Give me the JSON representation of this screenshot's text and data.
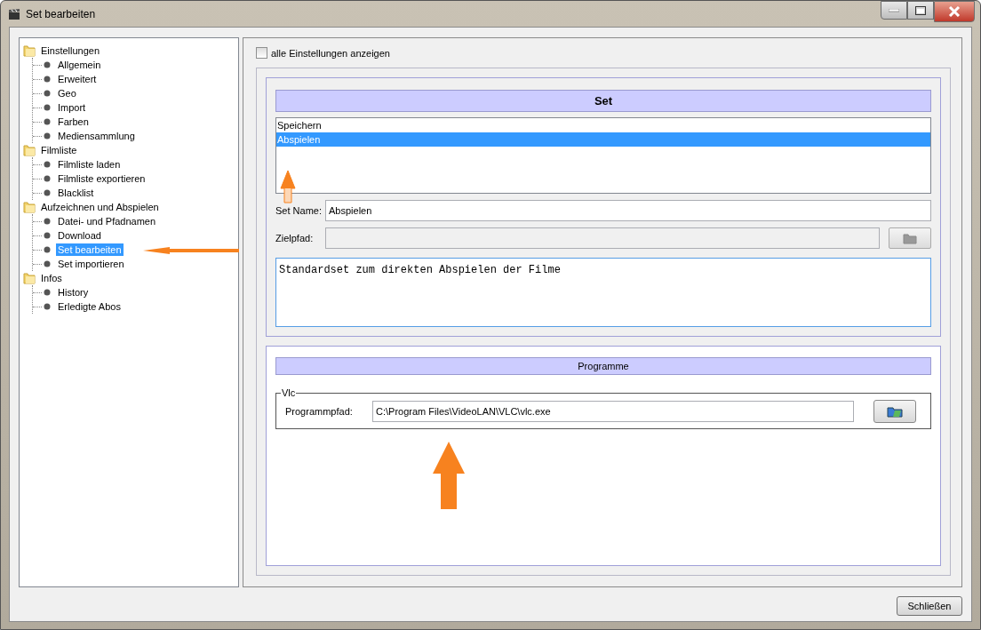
{
  "window": {
    "title": "Set bearbeiten"
  },
  "tree": [
    {
      "label": "Einstellungen",
      "children": [
        {
          "label": "Allgemein",
          "selected": false
        },
        {
          "label": "Erweitert",
          "selected": false
        },
        {
          "label": "Geo",
          "selected": false
        },
        {
          "label": "Import",
          "selected": false
        },
        {
          "label": "Farben",
          "selected": false
        },
        {
          "label": "Mediensammlung",
          "selected": false
        }
      ]
    },
    {
      "label": "Filmliste",
      "children": [
        {
          "label": "Filmliste laden",
          "selected": false
        },
        {
          "label": "Filmliste exportieren",
          "selected": false
        },
        {
          "label": "Blacklist",
          "selected": false
        }
      ]
    },
    {
      "label": "Aufzeichnen und Abspielen",
      "children": [
        {
          "label": "Datei- und Pfadnamen",
          "selected": false
        },
        {
          "label": "Download",
          "selected": false
        },
        {
          "label": "Set bearbeiten",
          "selected": true
        },
        {
          "label": "Set importieren",
          "selected": false
        }
      ]
    },
    {
      "label": "Infos",
      "children": [
        {
          "label": "History",
          "selected": false
        },
        {
          "label": "Erledigte Abos",
          "selected": false
        }
      ]
    }
  ],
  "show_all": {
    "label": "alle Einstellungen anzeigen",
    "checked": false
  },
  "set_panel": {
    "title": "Set",
    "sets": [
      {
        "label": "Speichern",
        "selected": false
      },
      {
        "label": "Abspielen",
        "selected": true
      }
    ],
    "name_label": "Set Name:",
    "name_value": "Abspielen",
    "target_label": "Zielpfad:",
    "description": "Standardset zum direkten Abspielen der Filme"
  },
  "programs_panel": {
    "title": "Programme",
    "group": "Vlc",
    "path_label": "Programmpfad:",
    "path_value": "C:\\Program Files\\VideoLAN\\VLC\\vlc.exe"
  },
  "close_button": "Schließen"
}
